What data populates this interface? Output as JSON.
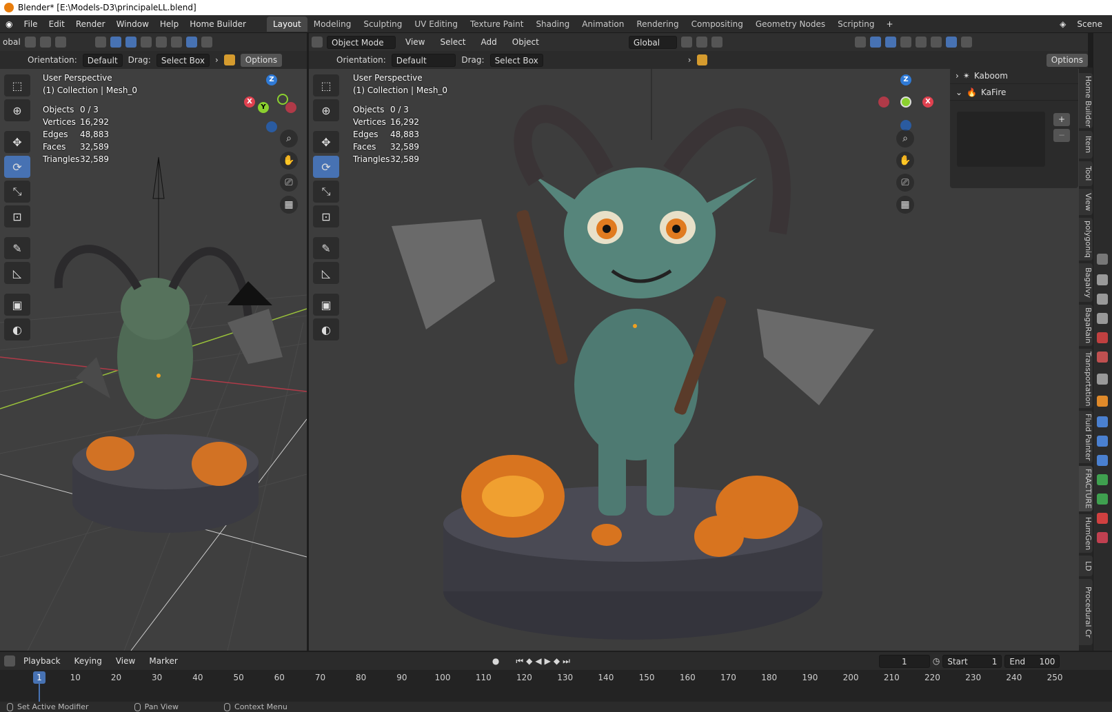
{
  "window": {
    "title": "Blender* [E:\\Models-D3\\principaleLL.blend]"
  },
  "menu": [
    "File",
    "Edit",
    "Render",
    "Window",
    "Help",
    "Home Builder"
  ],
  "workspaces": [
    "Layout",
    "Modeling",
    "Sculpting",
    "UV Editing",
    "Texture Paint",
    "Shading",
    "Animation",
    "Rendering",
    "Compositing",
    "Geometry Nodes",
    "Scripting"
  ],
  "active_workspace": "Layout",
  "scene_label": "Scene",
  "left_viewport": {
    "header_global_partial": "obal",
    "orientation_label": "Orientation:",
    "orientation_value": "Default",
    "drag_label": "Drag:",
    "drag_value": "Select Box",
    "options_label": "Options",
    "perspective": "User Perspective",
    "collection": "(1) Collection | Mesh_0",
    "stats": [
      {
        "k": "Objects",
        "v": "0 / 3"
      },
      {
        "k": "Vertices",
        "v": "16,292"
      },
      {
        "k": "Edges",
        "v": "48,883"
      },
      {
        "k": "Faces",
        "v": "32,589"
      },
      {
        "k": "Triangles",
        "v": "32,589"
      }
    ]
  },
  "right_viewport": {
    "mode": "Object Mode",
    "menus": [
      "View",
      "Select",
      "Add",
      "Object"
    ],
    "transform_orientation": "Global",
    "orientation_label": "Orientation:",
    "orientation_value": "Default",
    "drag_label": "Drag:",
    "drag_value": "Select Box",
    "options_label": "Options",
    "perspective": "User Perspective",
    "collection": "(1) Collection | Mesh_0",
    "stats": [
      {
        "k": "Objects",
        "v": "0 / 3"
      },
      {
        "k": "Vertices",
        "v": "16,292"
      },
      {
        "k": "Edges",
        "v": "48,883"
      },
      {
        "k": "Faces",
        "v": "32,589"
      },
      {
        "k": "Triangles",
        "v": "32,589"
      }
    ]
  },
  "gizmo_axes": {
    "x": "X",
    "y": "Y",
    "z": "Z"
  },
  "npanel": {
    "items": [
      "Kaboom",
      "KaFire"
    ]
  },
  "side_tabs": [
    "Home Builder",
    "Item",
    "Tool",
    "View",
    "polygoniq",
    "Bagalvy",
    "BagaRain",
    "Transportation",
    "Fluid Painter",
    "FRACTURE",
    "HumGen",
    "LD",
    "Procedural Cr"
  ],
  "timeline": {
    "menus": [
      "Playback",
      "Keying",
      "View",
      "Marker"
    ],
    "current_frame": "1",
    "start_label": "Start",
    "start_value": "1",
    "end_label": "End",
    "end_value": "100",
    "ticks": [
      "1",
      "10",
      "20",
      "30",
      "40",
      "50",
      "60",
      "70",
      "80",
      "90",
      "100",
      "110",
      "120",
      "130",
      "140",
      "150",
      "160",
      "170",
      "180",
      "190",
      "200",
      "210",
      "220",
      "230",
      "240",
      "250"
    ]
  },
  "statusbar": [
    "Set Active Modifier",
    "Pan View",
    "Context Menu"
  ],
  "colors": {
    "accent": "#4772b3",
    "viewport_bg": "#3d3d3d",
    "header_bg": "#2b2b2b",
    "axis_x": "#e0414f",
    "axis_y": "#8bd02f",
    "axis_z": "#2f7ad6"
  }
}
